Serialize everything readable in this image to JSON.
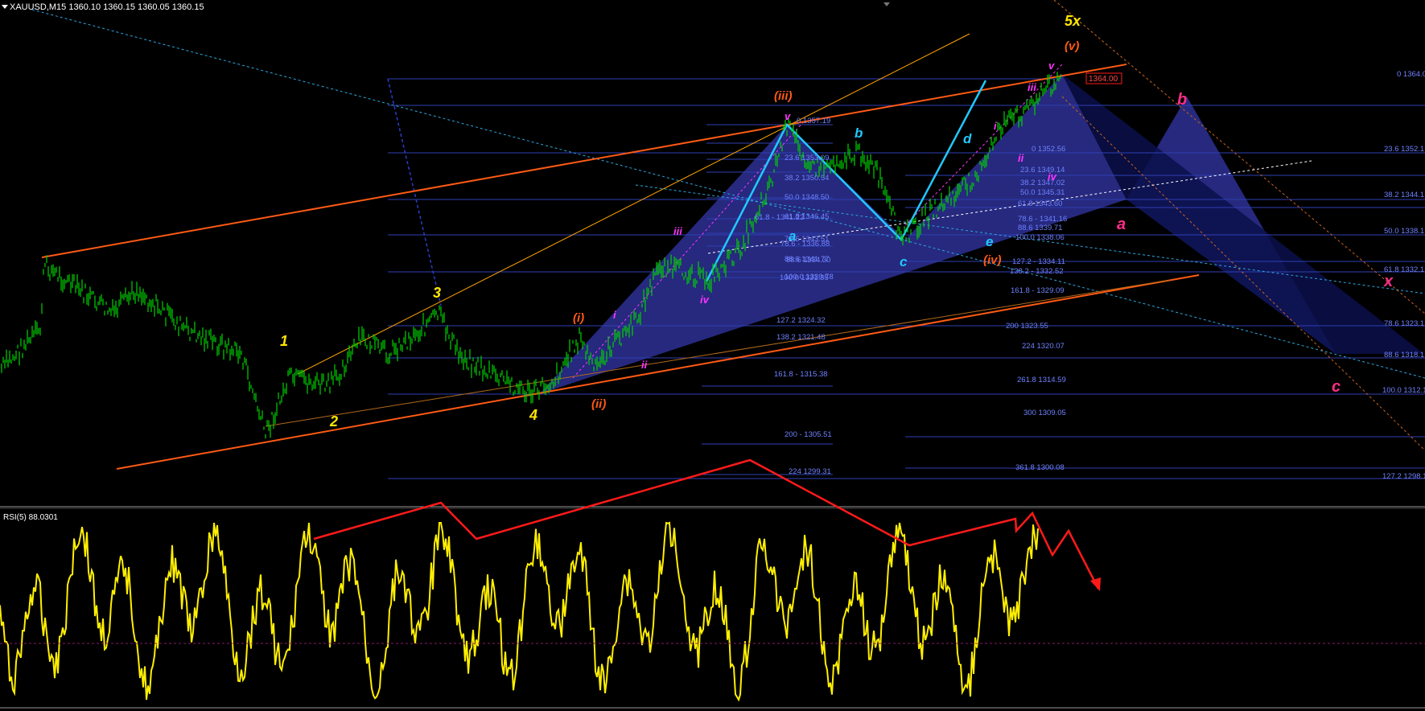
{
  "header": {
    "title": "XAUUSD,M15  1360.10 1360.15 1360.05 1360.15",
    "rsi_title": "RSI(5) 88.0301",
    "price_marker": "1364.00"
  },
  "colors": {
    "background": "#000000",
    "candles": "#00d200",
    "channel": "#ff5a14",
    "fib_lines": "#2f3fb4",
    "fib_text": "#6f82ff",
    "pattern_fill": "#2a2e8c",
    "abcde_lines": "#22c8ff",
    "rsi_line": "#ffef00",
    "rsi_arrows": "#ff1a1a",
    "wave_yellow": "#ffe600",
    "wave_orange": "#ff5a14",
    "wave_magenta": "#ff33ff",
    "wave_cyan": "#22c8ff",
    "wave_pink": "#ff2d87"
  },
  "fib_labels_a": [
    "0 1357.19",
    "23.6 1353.09",
    "38.2 1350.54",
    "50.0 1348.50",
    "61.8 1346.45",
    "78.6 1343.51",
    "88.6 1341.77",
    "100.0 1339.78",
    "127.2 1324.32",
    "138.2 1321.48",
    "161.8 - 1315.38",
    "200 - 1305.51",
    "224 1299.31"
  ],
  "fib_labels_b": [
    "61.8 - 1341.22",
    "78.6 - 1336.88",
    "88.6 1334.30",
    "100.0 1331.35"
  ],
  "fib_labels_c": [
    "0 1352.56",
    "23.6 1349.14",
    "38.2 1347.02",
    "50.0 1345.31",
    "61.8 1343.60",
    "78.6 - 1341.16",
    "88.6 1339.71",
    "100.0 1338.06",
    "127.2 - 1334.11",
    "138.2 - 1332.52",
    "161.8 - 1329.09",
    "200 1323.55",
    "224 1320.07",
    "261.8 1314.59",
    "300 1309.05",
    "361.8 1300.08"
  ],
  "fib_labels_right": [
    "0 1364.0",
    "23.6 1352.1",
    "38.2 1344.1",
    "50.0 1338.1",
    "61.8 1332.1",
    "78.6 1323.1",
    "88.6 1318.1",
    "100.0 1312.1",
    "127.2 1298.1"
  ],
  "wave_labels": {
    "yellow": [
      "1",
      "2",
      "3",
      "4",
      "5x"
    ],
    "orange": [
      "(i)",
      "(ii)",
      "(iii)",
      "(iv)",
      "(v)"
    ],
    "magenta": [
      "i",
      "ii",
      "iii",
      "iv",
      "v",
      "i",
      "ii",
      "iii",
      "iv",
      "v",
      "iii",
      "iv",
      "v",
      "ii"
    ],
    "cyan": [
      "a",
      "b",
      "c",
      "d",
      "e"
    ],
    "pink": [
      "a",
      "b",
      "c",
      "x"
    ]
  },
  "chart_data": [
    {
      "type": "candlestick",
      "title": "XAUUSD,M15",
      "last": {
        "open": 1360.1,
        "high": 1360.15,
        "low": 1360.05,
        "close": 1360.15
      },
      "marked_price": 1364.0,
      "y_range_approx": [
        1298,
        1366
      ],
      "overlays": [
        "Elliott wave labels",
        "Fibonacci retracement/extension levels",
        "trend channel",
        "harmonic pattern"
      ]
    },
    {
      "type": "line",
      "title": "RSI(5)",
      "last_value": 88.0301,
      "series": [
        {
          "name": "RSI(5)"
        }
      ]
    }
  ]
}
